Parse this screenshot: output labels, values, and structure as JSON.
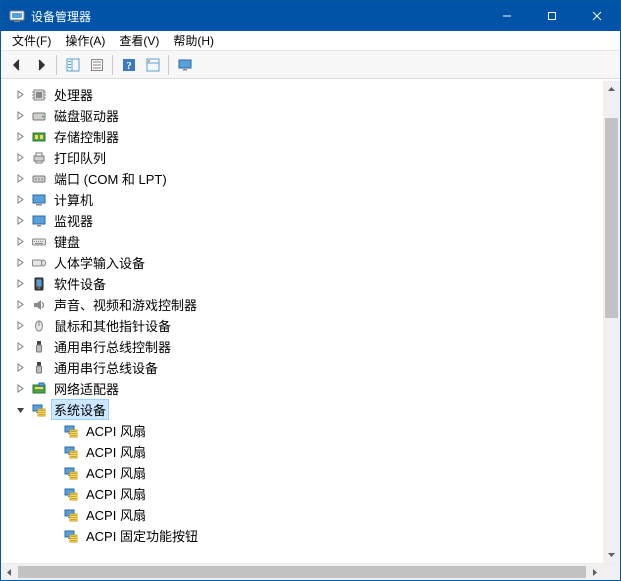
{
  "title": "设备管理器",
  "menubar": {
    "file": "文件(F)",
    "action": "操作(A)",
    "view": "查看(V)",
    "help": "帮助(H)"
  },
  "tree": {
    "top_nodes": [
      {
        "icon": "cpu",
        "label": "处理器"
      },
      {
        "icon": "disk",
        "label": "磁盘驱动器"
      },
      {
        "icon": "storage-ctrl",
        "label": "存储控制器"
      },
      {
        "icon": "printer",
        "label": "打印队列"
      },
      {
        "icon": "port",
        "label": "端口 (COM 和 LPT)"
      },
      {
        "icon": "computer",
        "label": "计算机"
      },
      {
        "icon": "monitor",
        "label": "监视器"
      },
      {
        "icon": "keyboard",
        "label": "键盘"
      },
      {
        "icon": "hid",
        "label": "人体学输入设备"
      },
      {
        "icon": "software",
        "label": "软件设备"
      },
      {
        "icon": "audio",
        "label": "声音、视频和游戏控制器"
      },
      {
        "icon": "mouse",
        "label": "鼠标和其他指针设备"
      },
      {
        "icon": "usb-ctrl",
        "label": "通用串行总线控制器"
      },
      {
        "icon": "usb-dev",
        "label": "通用串行总线设备"
      },
      {
        "icon": "network",
        "label": "网络适配器"
      }
    ],
    "expanded_node": {
      "icon": "system-device",
      "label": "系统设备"
    },
    "children": [
      {
        "icon": "system-device",
        "label": "ACPI 风扇"
      },
      {
        "icon": "system-device",
        "label": "ACPI 风扇"
      },
      {
        "icon": "system-device",
        "label": "ACPI 风扇"
      },
      {
        "icon": "system-device",
        "label": "ACPI 风扇"
      },
      {
        "icon": "system-device",
        "label": "ACPI 风扇"
      },
      {
        "icon": "system-device",
        "label": "ACPI 固定功能按钮"
      }
    ]
  }
}
